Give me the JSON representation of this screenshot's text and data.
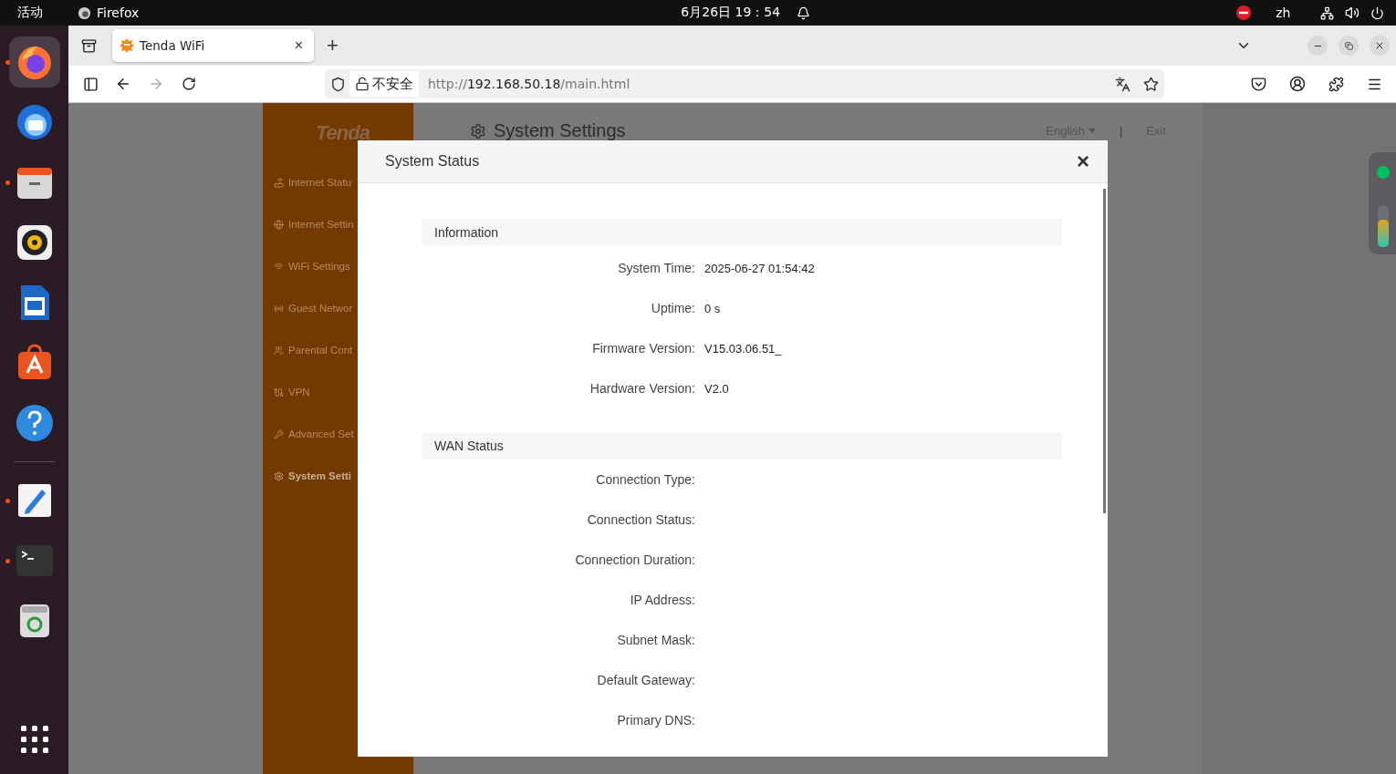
{
  "top_bar": {
    "activities": "活动",
    "app": "Firefox",
    "clock": "6月26日 19：54",
    "input_method": "zh"
  },
  "dock": {
    "apps": [
      {
        "kind": "firefox",
        "running": true,
        "selected": true
      },
      {
        "kind": "thunderbird",
        "running": false,
        "selected": false
      },
      {
        "kind": "files",
        "running": true,
        "selected": false
      },
      {
        "kind": "rhythmbox",
        "running": false,
        "selected": false
      },
      {
        "kind": "writer",
        "running": false,
        "selected": false
      },
      {
        "kind": "appcenter",
        "running": false,
        "selected": false
      },
      {
        "kind": "help",
        "running": false,
        "selected": false
      },
      {
        "kind": "separator"
      },
      {
        "kind": "editor",
        "running": true,
        "selected": false
      },
      {
        "kind": "terminal",
        "running": true,
        "selected": false
      },
      {
        "kind": "trash",
        "running": false,
        "selected": false
      }
    ]
  },
  "browser": {
    "tabs": [
      {
        "title": "Tenda WiFi",
        "close": "×",
        "selected": true
      }
    ],
    "new_tab": "+",
    "security_label": "不安全",
    "url": {
      "scheme": "http://",
      "host": "192.168.50.18",
      "path": "/main.html"
    }
  },
  "router": {
    "logo": "Tenda",
    "page_title": "System Settings",
    "language": "English",
    "divider": "|",
    "exit": "Exit",
    "menu": [
      {
        "label": "Internet Statu",
        "selected": false
      },
      {
        "label": "Internet Settin",
        "selected": false
      },
      {
        "label": "WiFi Settings",
        "selected": false
      },
      {
        "label": "Guest Networ",
        "selected": false
      },
      {
        "label": "Parental Cont",
        "selected": false
      },
      {
        "label": "VPN",
        "selected": false
      },
      {
        "label": "Advanced Set",
        "selected": false
      },
      {
        "label": "System Setti",
        "selected": true
      }
    ]
  },
  "dialog": {
    "title": "System Status",
    "close": "×",
    "sections": [
      {
        "title": "Information",
        "rows": [
          {
            "label": "System Time:",
            "value": "2025-06-27 01:54:42"
          },
          {
            "label": "Uptime:",
            "value": "0 s"
          },
          {
            "label": "Firmware Version:",
            "value": "V15.03.06.51_"
          },
          {
            "label": "Hardware Version:",
            "value": "V2.0"
          }
        ]
      },
      {
        "title": "WAN Status",
        "rows": [
          {
            "label": "Connection Type:"
          },
          {
            "label": "Connection Status:"
          },
          {
            "label": "Connection Duration:"
          },
          {
            "label": "IP Address:"
          },
          {
            "label": "Subnet Mask:"
          },
          {
            "label": "Default Gateway:"
          },
          {
            "label": "Primary DNS:"
          }
        ]
      }
    ]
  }
}
